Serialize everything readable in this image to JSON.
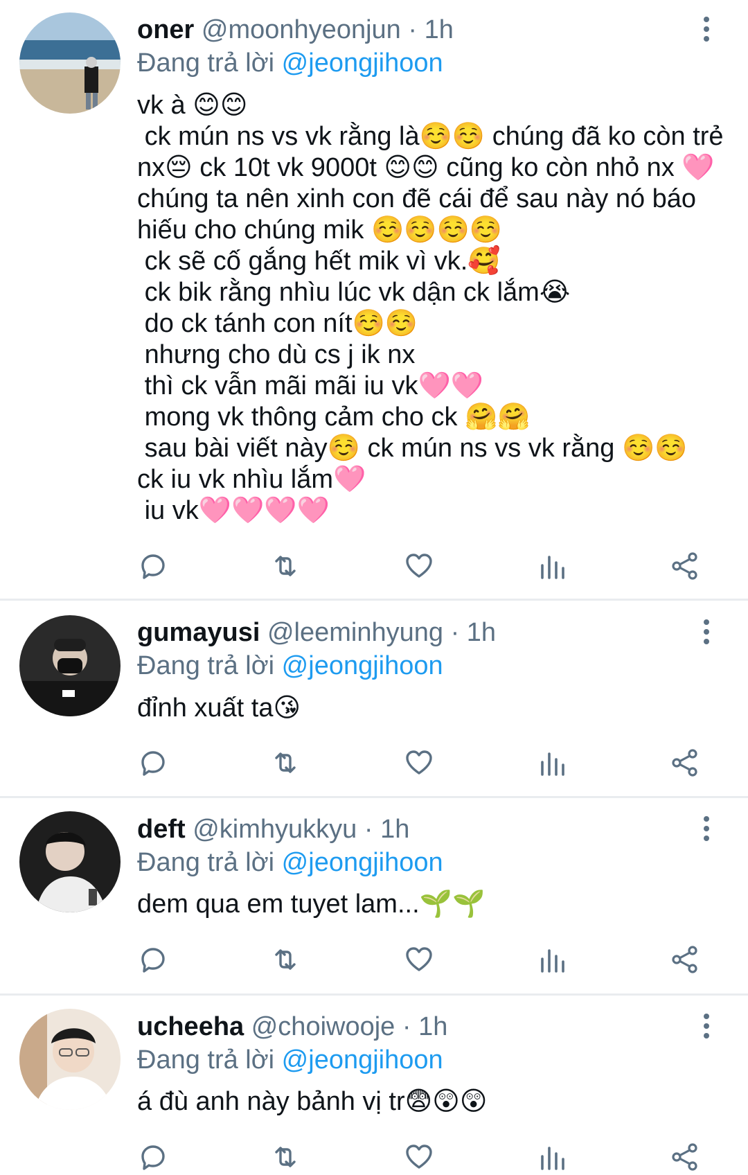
{
  "tweets": [
    {
      "name": "oner",
      "handle": "@moonhyeonjun",
      "dot": "·",
      "time": "1h",
      "reply_prefix": "Đang trả lời",
      "reply_to": "@jeongjihoon",
      "text": "vk à 😊😊\n ck mún ns vs vk rằng là☺️☺️ chúng đã ko còn trẻ nx😔 ck 10t vk 9000t 😊😊 cũng ko còn nhỏ nx 🩷 chúng ta nên xinh con đẽ cái để sau này nó báo hiếu cho chúng mik ☺️☺️☺️☺️\n ck sẽ cố gắng hết mik vì vk.🥰\n ck bik rằng nhìu lúc vk dận ck lắm😭\n do ck tánh con nít☺️☺️\n nhưng cho dù cs j ik nx\n thì ck vẫn mãi mãi iu vk🩷🩷\n mong vk thông cảm cho ck 🤗🤗\n sau bài viết này☺️ ck mún ns vs vk rằng ☺️☺️\nck iu vk nhìu lắm🩷\n iu vk🩷🩷🩷🩷"
    },
    {
      "name": "gumayusi",
      "handle": "@leeminhyung",
      "dot": "·",
      "time": "1h",
      "reply_prefix": "Đang trả lời",
      "reply_to": "@jeongjihoon",
      "text": "đỉnh xuất ta😘"
    },
    {
      "name": "deft",
      "handle": "@kimhyukkyu",
      "dot": "·",
      "time": "1h",
      "reply_prefix": "Đang trả lời",
      "reply_to": "@jeongjihoon",
      "text": "dem qua em tuyet lam...🌱🌱"
    },
    {
      "name": "ucheeha",
      "handle": "@choiwooje",
      "dot": "·",
      "time": "1h",
      "reply_prefix": "Đang trả lời",
      "reply_to": "@jeongjihoon",
      "text": "á đù anh này bảnh vị tr😨😲😲"
    }
  ],
  "icons": {
    "reply": "reply-icon",
    "retweet": "retweet-icon",
    "like": "heart-icon",
    "views": "analytics-icon",
    "share": "share-icon",
    "more": "more-vertical-icon"
  },
  "colors": {
    "text": "#0f1419",
    "secondary": "#5b7083",
    "mention": "#1d9bf0",
    "divider": "#e9ecef"
  }
}
